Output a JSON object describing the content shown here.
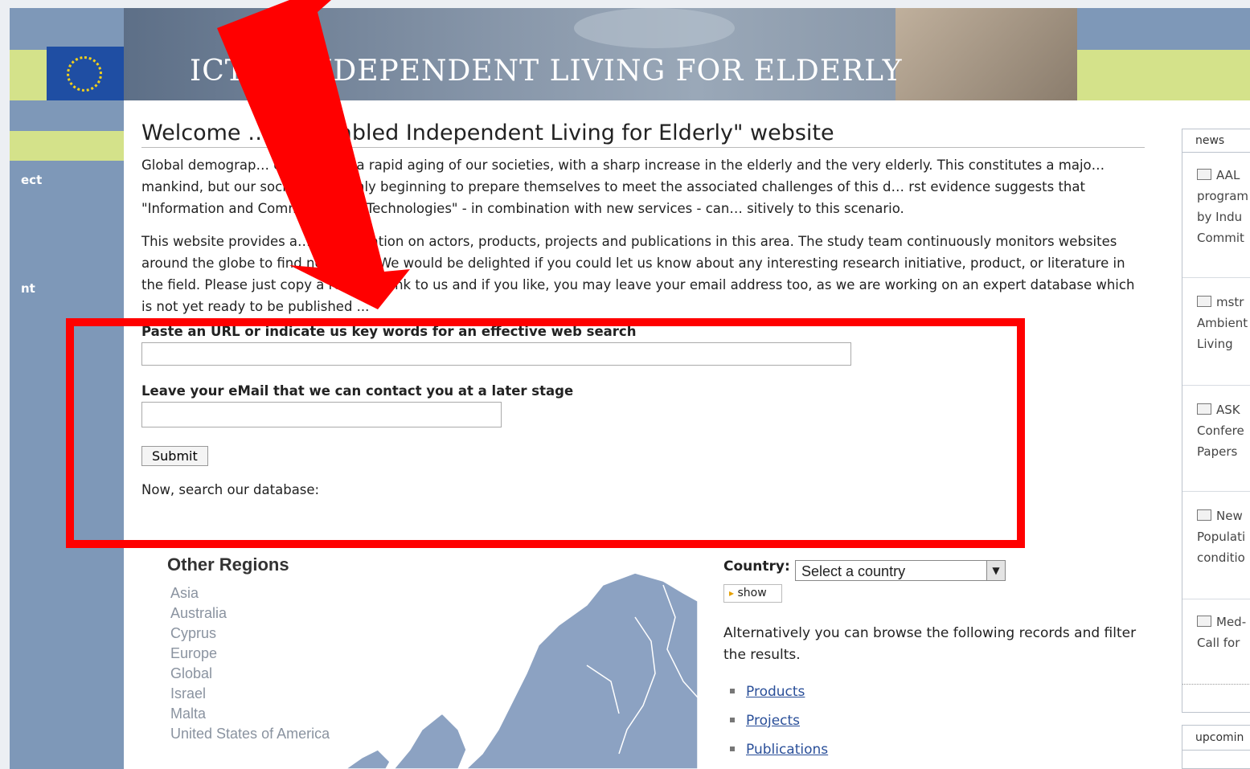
{
  "header": {
    "title": "ICT — INDEPENDENT LIVING FOR ELDERLY"
  },
  "leftnav": {
    "items": [
      "ect",
      "nt"
    ]
  },
  "main": {
    "heading": "Welcome … CT enabled Independent Living for Elderly\" website",
    "intro": [
      "Global demograp… e leading to a rapid aging of our societies, with a sharp increase in the elderly and the very elderly. This constitutes a majo… mankind, but our societies are only beginning to prepare themselves to meet the associated challenges of this d… rst evidence suggests that \"Information and Communication Technologies\" - in combination with new services - can… sitively to this scenario.",
      "This website provides a… o information on actors, products, projects and publications in this area. The study team continuously monitors websites around the globe to find new facts. We would be delighted if you could let us know about any interesting research initiative, product, or literature in the field. Please just copy a relevant link to us and if you like, you may leave your email address too, as we are working on an expert database which is not yet ready to be published ..."
    ],
    "url_label": "Paste an URL or indicate us key words for an effective web search",
    "email_label": "Leave your eMail that we can contact you at a later stage",
    "submit_label": "Submit",
    "search_text": "Now, search our database:"
  },
  "regions": {
    "title": "Other Regions",
    "items": [
      "Asia",
      "Australia",
      "Cyprus",
      "Europe",
      "Global",
      "Israel",
      "Malta",
      "United States of America"
    ]
  },
  "country": {
    "label": "Country:",
    "selected": "Select a country",
    "show_label": "show",
    "alt_text": "Alternatively you can browse the following records and filter the results.",
    "records": [
      "Products",
      "Projects",
      "Publications"
    ]
  },
  "news": {
    "head": "news",
    "items": [
      [
        "AAL",
        "program",
        "by Indu",
        "Commit"
      ],
      [
        "mstr",
        "Ambient",
        "Living"
      ],
      [
        "ASK",
        "Confere",
        "Papers"
      ],
      [
        "New",
        "Populati",
        "conditio"
      ],
      [
        "Med-",
        "Call for"
      ]
    ]
  },
  "upcoming": {
    "head": "upcomin"
  },
  "annotation_color": "#ff0000"
}
